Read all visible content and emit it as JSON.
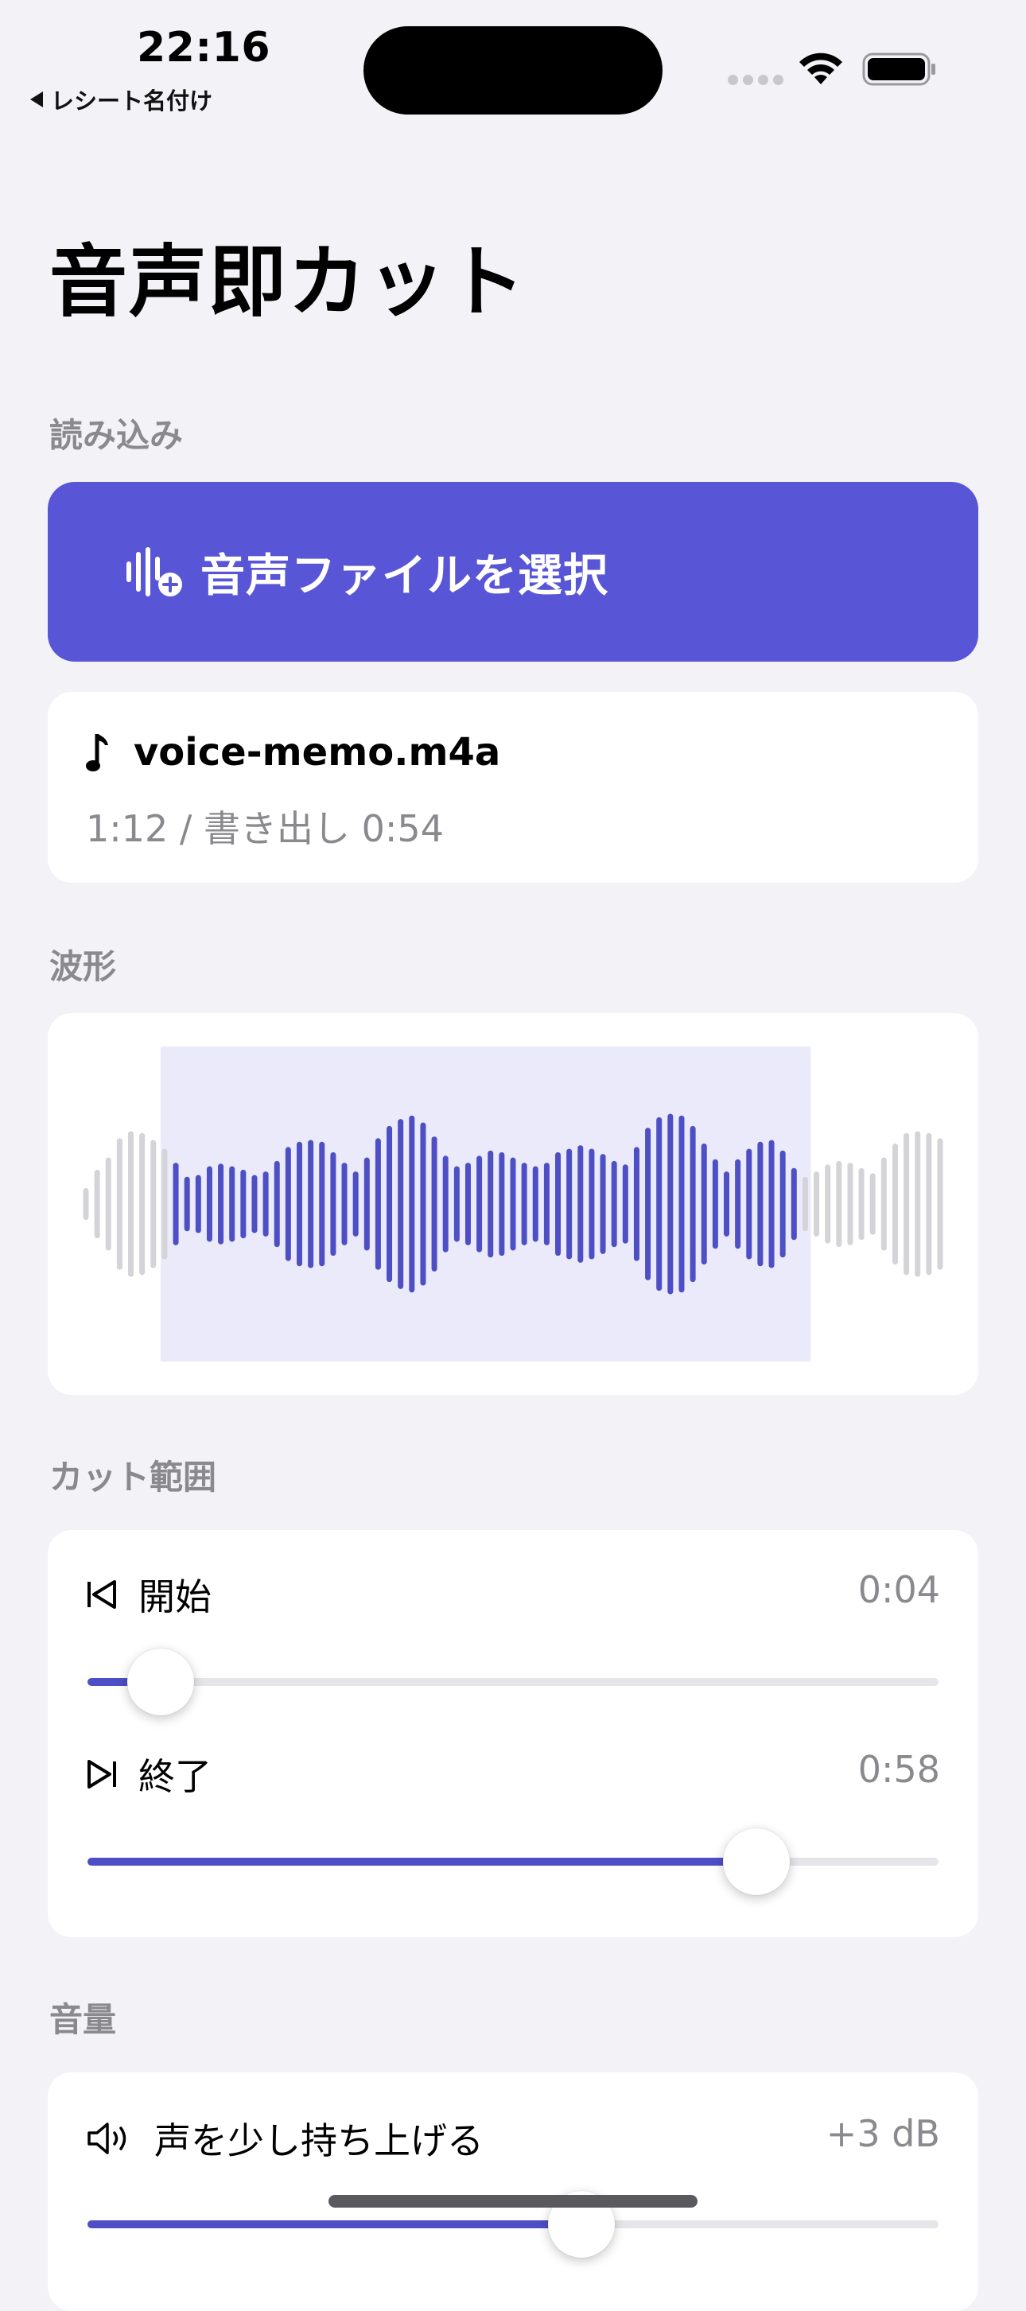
{
  "status_bar": {
    "time": "22:16",
    "back_label": "レシート名付け"
  },
  "header": {
    "title": "音声即カット"
  },
  "sections": {
    "load": "読み込み",
    "waveform": "波形",
    "cut_range": "カット範囲",
    "volume": "音量"
  },
  "load": {
    "button_label": "音声ファイルを選択",
    "button_icon": "waveform-plus-icon"
  },
  "file": {
    "icon": "music-note-icon",
    "name": "voice-memo.m4a",
    "meta": "1:12 / 書き出し 0:54"
  },
  "waveform": {
    "amplitudes": [
      0.15,
      0.36,
      0.5,
      0.72,
      0.8,
      0.78,
      0.7,
      0.6,
      0.44,
      0.28,
      0.3,
      0.4,
      0.43,
      0.4,
      0.36,
      0.3,
      0.34,
      0.46,
      0.62,
      0.68,
      0.7,
      0.68,
      0.56,
      0.44,
      0.34,
      0.5,
      0.72,
      0.86,
      0.94,
      0.98,
      0.9,
      0.74,
      0.52,
      0.4,
      0.44,
      0.52,
      0.58,
      0.56,
      0.5,
      0.44,
      0.4,
      0.44,
      0.56,
      0.6,
      0.64,
      0.6,
      0.54,
      0.46,
      0.42,
      0.62,
      0.84,
      0.96,
      1.0,
      0.98,
      0.86,
      0.66,
      0.48,
      0.34,
      0.48,
      0.6,
      0.68,
      0.7,
      0.58,
      0.38,
      0.28,
      0.34,
      0.42,
      0.46,
      0.44,
      0.38,
      0.32,
      0.5,
      0.66,
      0.78,
      0.8,
      0.78,
      0.72
    ],
    "selection": {
      "start": 0.094,
      "end": 0.842
    },
    "active_color": "#4e4fc4",
    "inactive_color": "#d4d4d8",
    "selection_color": "#eaeafa"
  },
  "cut_range": {
    "start": {
      "icon": "skip-start-icon",
      "label": "開始",
      "value": "0:04",
      "fraction": 0.086
    },
    "end": {
      "icon": "skip-end-icon",
      "label": "終了",
      "value": "0:58",
      "fraction": 0.786
    }
  },
  "volume": {
    "icon": "speaker-icon",
    "label": "声を少し持ち上げる",
    "value": "+3 dB",
    "fraction": 0.58
  },
  "colors": {
    "accent": "#5856d6",
    "slider_fill": "#4e4fc4",
    "background": "#f2f2f7"
  }
}
